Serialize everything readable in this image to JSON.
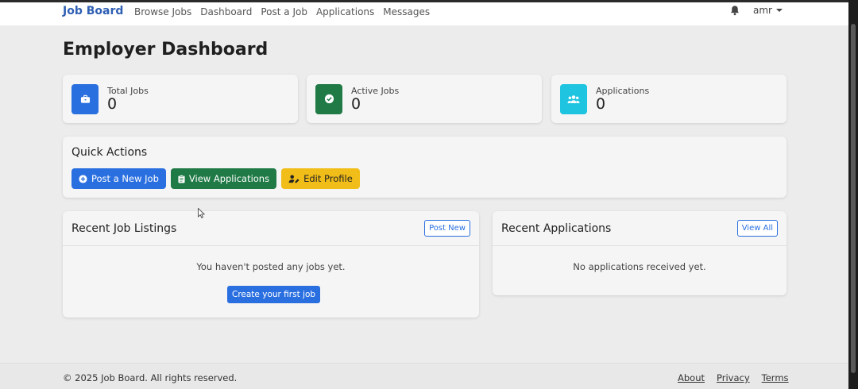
{
  "navbar": {
    "brand": "Job Board",
    "links": [
      "Browse Jobs",
      "Dashboard",
      "Post a Job",
      "Applications",
      "Messages"
    ],
    "user": "amr"
  },
  "page": {
    "title": "Employer Dashboard"
  },
  "stats": [
    {
      "label": "Total Jobs",
      "value": "0",
      "icon": "briefcase-icon",
      "color": "#2a6fe0"
    },
    {
      "label": "Active Jobs",
      "value": "0",
      "icon": "check-circle-icon",
      "color": "#1f7a46"
    },
    {
      "label": "Applications",
      "value": "0",
      "icon": "users-icon",
      "color": "#1ec4e0"
    }
  ],
  "quick_actions": {
    "title": "Quick Actions",
    "post_job": "Post a New Job",
    "view_applications": "View Applications",
    "edit_profile": "Edit Profile"
  },
  "recent_jobs": {
    "title": "Recent Job Listings",
    "action": "Post New",
    "empty": "You haven't posted any jobs yet.",
    "create": "Create your first job"
  },
  "recent_applications": {
    "title": "Recent Applications",
    "action": "View All",
    "empty": "No applications received yet."
  },
  "footer": {
    "copyright": "© 2025 Job Board. All rights reserved.",
    "about": "About",
    "privacy": "Privacy",
    "terms": "Terms"
  }
}
